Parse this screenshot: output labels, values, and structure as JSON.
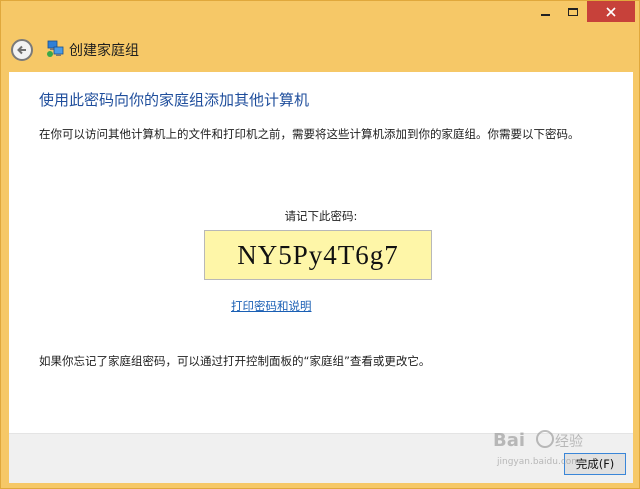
{
  "window": {
    "title": "创建家庭组",
    "caption_buttons": [
      "minimize",
      "maximize",
      "close"
    ],
    "accent_color": "#f6c867",
    "close_color": "#c7413a"
  },
  "header": {
    "back_icon": "back-arrow-icon",
    "app_icon": "homegroup-icon"
  },
  "content": {
    "heading": "使用此密码向你的家庭组添加其他计算机",
    "description": "在你可以访问其他计算机上的文件和打印机之前，需要将这些计算机添加到你的家庭组。你需要以下密码。",
    "password_label": "请记下此密码:",
    "password": "NY5Py4T6g7",
    "print_link": "打印密码和说明",
    "footer_text": "如果你忘记了家庭组密码，可以通过打开控制面板的“家庭组”查看或更改它。"
  },
  "footer": {
    "finish_button": "完成(F)"
  }
}
